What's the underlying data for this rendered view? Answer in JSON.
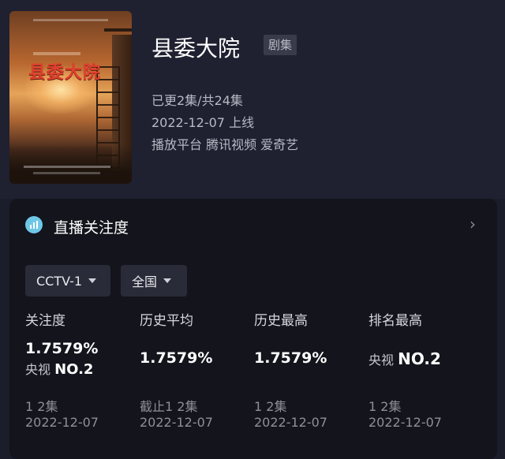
{
  "show": {
    "title": "县委大院",
    "tag": "剧集",
    "poster_title": "县委大院",
    "update_status": "已更2集/共24集",
    "release": "2022-12-07 上线",
    "platforms": "播放平台 腾讯视频 爱奇艺"
  },
  "card": {
    "title": "直播关注度",
    "icon": "chart-icon",
    "chevron": "›",
    "channel_select": "CCTV-1",
    "region_select": "全国"
  },
  "stats": [
    {
      "label": "关注度",
      "value": "1.7579%",
      "sub_prefix": "央视",
      "sub_value": "NO.2",
      "episode": "1 2集",
      "date": "2022-12-07"
    },
    {
      "label": "历史平均",
      "value": "1.7579%",
      "episode": "截止1 2集",
      "date": "2022-12-07"
    },
    {
      "label": "历史最高",
      "value": "1.7579%",
      "episode": "1 2集",
      "date": "2022-12-07"
    },
    {
      "label": "排名最高",
      "sub_prefix": "央视",
      "sub_value": "NO.2",
      "episode": "1 2集",
      "date": "2022-12-07"
    }
  ]
}
